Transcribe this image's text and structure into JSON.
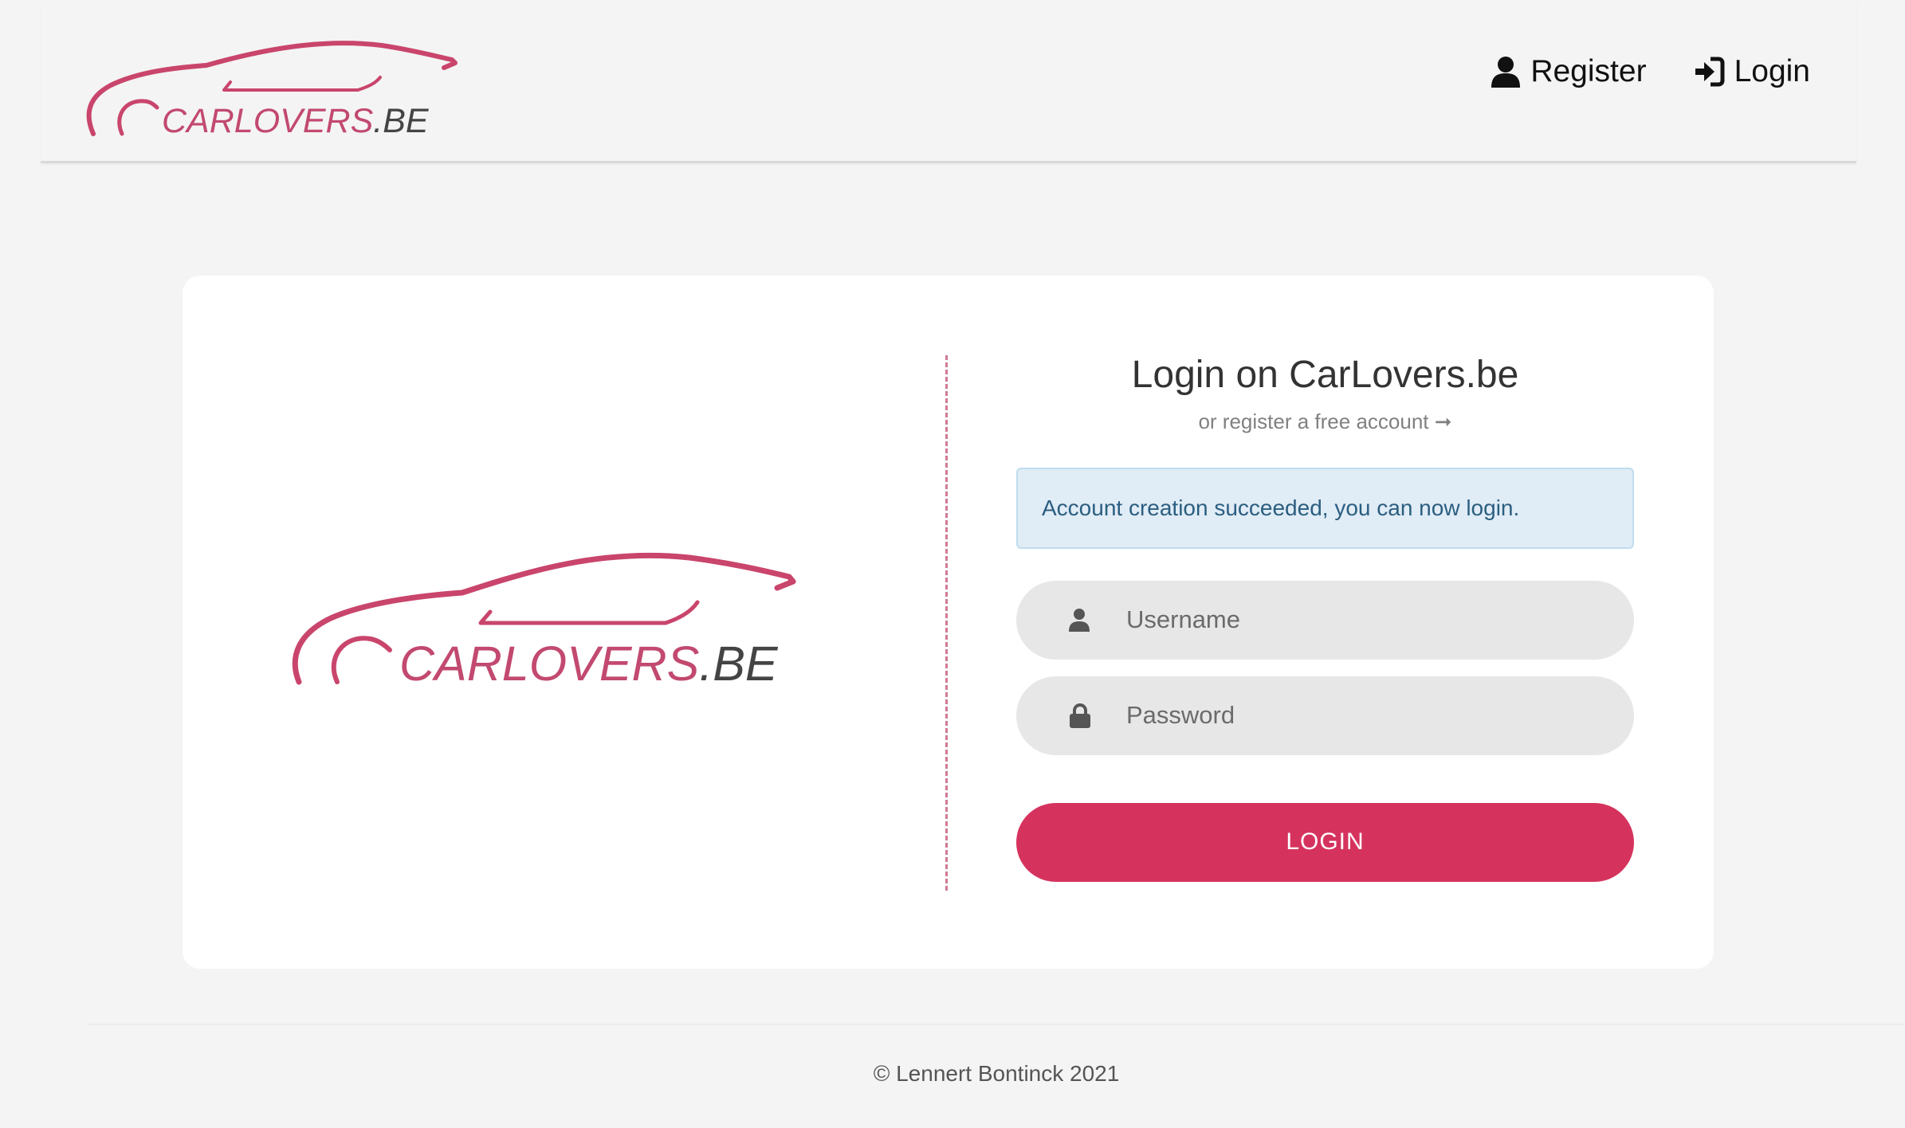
{
  "brand": {
    "logo_main": "CARLOVERS",
    "logo_suffix": ".BE",
    "primary_color": "#d5335e",
    "logo_text_color": "#c2496f",
    "logo_suffix_color": "#444444"
  },
  "nav": {
    "register": {
      "label": "Register",
      "icon": "user-icon"
    },
    "login": {
      "label": "Login",
      "icon": "sign-in-icon"
    }
  },
  "form": {
    "title": "Login on CarLovers.be",
    "subtitle": "or register a free account ➞",
    "alert": "Account creation succeeded, you can now login.",
    "username": {
      "placeholder": "Username",
      "value": "",
      "icon": "user-icon"
    },
    "password": {
      "placeholder": "Password",
      "value": "",
      "icon": "lock-icon"
    },
    "submit_label": "LOGIN"
  },
  "footer": {
    "copyright": "© Lennert Bontinck 2021"
  }
}
